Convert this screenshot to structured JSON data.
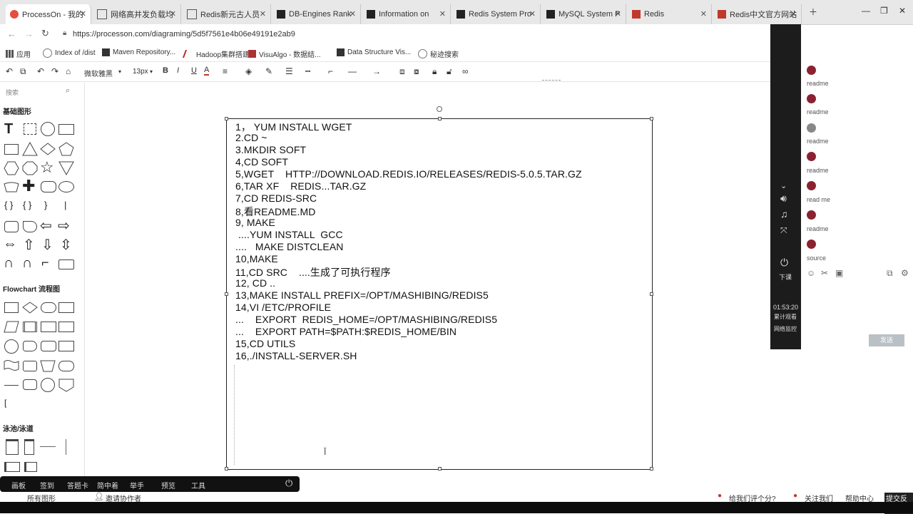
{
  "browser": {
    "tabs": [
      {
        "label": "ProcessOn - 我的",
        "active": true
      },
      {
        "label": "网络高并发负载均"
      },
      {
        "label": "Redis新元古人员"
      },
      {
        "label": "DB-Engines Rank"
      },
      {
        "label": "Information on"
      },
      {
        "label": "Redis System Pro"
      },
      {
        "label": "MySQL System P"
      },
      {
        "label": "Redis"
      },
      {
        "label": "Redis中文官方网站"
      }
    ],
    "url": "https://processon.com/diagraming/5d5f7561e4b06e49191e2ab9",
    "bookmarks": [
      "应用",
      "Index of /dist",
      "Maven Repository...",
      "Hadoop集群搭建",
      "VisuAlgo - 数据结...",
      "Data Structure Vis...",
      "秘迹搜索"
    ]
  },
  "toolbar": {
    "font_name": "微软雅黑",
    "font_size": "13px",
    "bold": "B",
    "italic": "I",
    "underline": "U",
    "font_color": "A"
  },
  "shapes_panel": {
    "search_placeholder": "搜索",
    "sections": [
      "基础图形",
      "Flowchart 流程图",
      "泳池/泳道"
    ]
  },
  "canvas": {
    "lines": [
      "1， YUM INSTALL WGET",
      "2.CD ~",
      "3.MKDIR SOFT",
      "4,CD SOFT",
      "5,WGET    HTTP://DOWNLOAD.REDIS.IO/RELEASES/REDIS-5.0.5.TAR.GZ",
      "6,TAR XF    REDIS...TAR.GZ",
      "7,CD REDIS-SRC",
      "8,看README.MD",
      "9, MAKE",
      " ....YUM INSTALL  GCC",
      "....   MAKE DISTCLEAN",
      "10,MAKE",
      "11,CD SRC    ....生成了可执行程序",
      "12, CD ..",
      "13,MAKE INSTALL PREFIX=/OPT/MASHIBING/REDIS5",
      "14,VI /ETC/PROFILE",
      "...    EXPORT  REDIS_HOME=/OPT/MASHIBING/REDIS5",
      "...    EXPORT PATH=$PATH:$REDIS_HOME/BIN",
      "15,CD UTILS",
      "16,./INSTALL-SERVER.SH"
    ]
  },
  "sidebar_strip": {
    "leave_label": "下课",
    "time": "01:53:20",
    "line1": "累计观看",
    "line2": "网络监控"
  },
  "comments": {
    "labels": [
      "readme",
      "readme",
      "readme",
      "readme",
      "read me",
      "readme",
      "source"
    ],
    "send_label": "发送"
  },
  "dock": {
    "items": [
      "画板",
      "签到",
      "答题卡",
      "简中着",
      "举手",
      "预览",
      "工具"
    ]
  },
  "status": {
    "left": "所有图形",
    "invite": "邀请协作者",
    "rate": "给我们评个分?",
    "follow": "关注我们",
    "help": "帮助中心",
    "feedback": "提交反馈"
  },
  "colors": {
    "accent_red": "#c0392b",
    "dark_strip": "#1c1c1c",
    "dock_bg": "#111111"
  }
}
